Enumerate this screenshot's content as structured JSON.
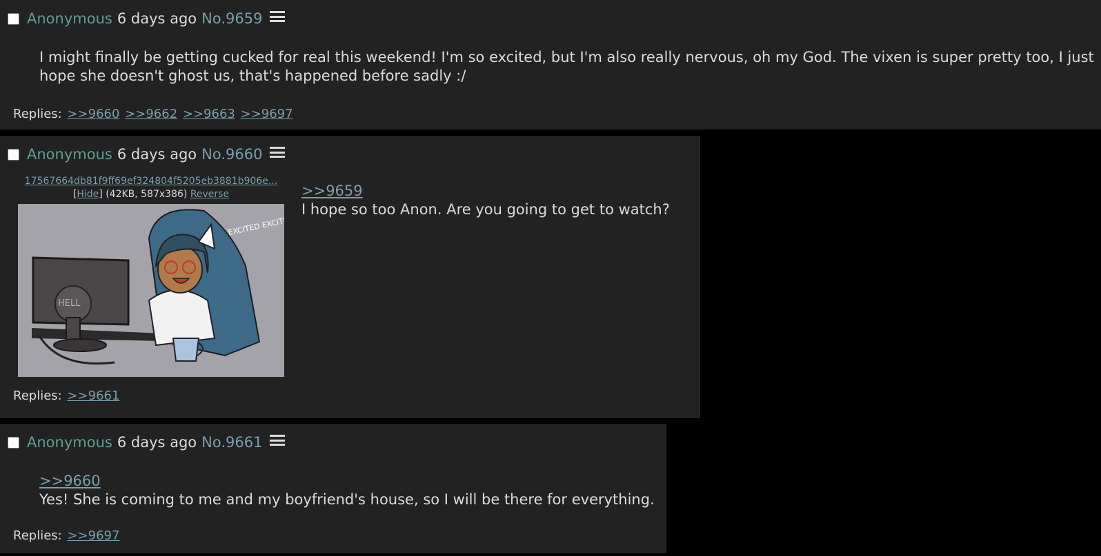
{
  "posts": [
    {
      "name": "Anonymous",
      "time": "6 days ago",
      "number": "No.9659",
      "lines": [
        "I might finally be getting cucked for real this weekend! I'm so excited, but I'm also really nervous, oh my God. The vixen is super pretty too, I just",
        "hope she doesn't ghost us, that's happened before sadly :/"
      ],
      "replies_label": "Replies:",
      "replies": [
        ">>9660",
        ">>9662",
        ">>9663",
        ">>9697"
      ]
    },
    {
      "name": "Anonymous",
      "time": "6 days ago",
      "number": "No.9660",
      "file": {
        "filename": "17567664db81f9ff69ef324804f5205eb3881b906e...",
        "bracket_open": "[",
        "hide_label": "Hide",
        "bracket_close": "]",
        "meta": "(42KB, 587x386)",
        "reverse_label": "Reverse",
        "image_text": "EXCITED EXCITED",
        "monitor_text": "HELL"
      },
      "quote": ">>9659",
      "lines": [
        "I hope so too Anon. Are you going to get to watch?"
      ],
      "replies_label": "Replies:",
      "replies": [
        ">>9661"
      ]
    },
    {
      "name": "Anonymous",
      "time": "6 days ago",
      "number": "No.9661",
      "quote": ">>9660",
      "lines": [
        "Yes! She is coming to me and my boyfriend's house, so I will be there for everything."
      ],
      "replies_label": "Replies:",
      "replies": [
        ">>9697"
      ]
    }
  ],
  "icons": {
    "menu": "hamburger-menu-icon",
    "checkbox": "post-select-checkbox"
  },
  "colors": {
    "background": "#000000",
    "post_background": "#222222",
    "name": "#5f9e93",
    "link": "#7a9fb0",
    "text": "#dcdcdc"
  }
}
